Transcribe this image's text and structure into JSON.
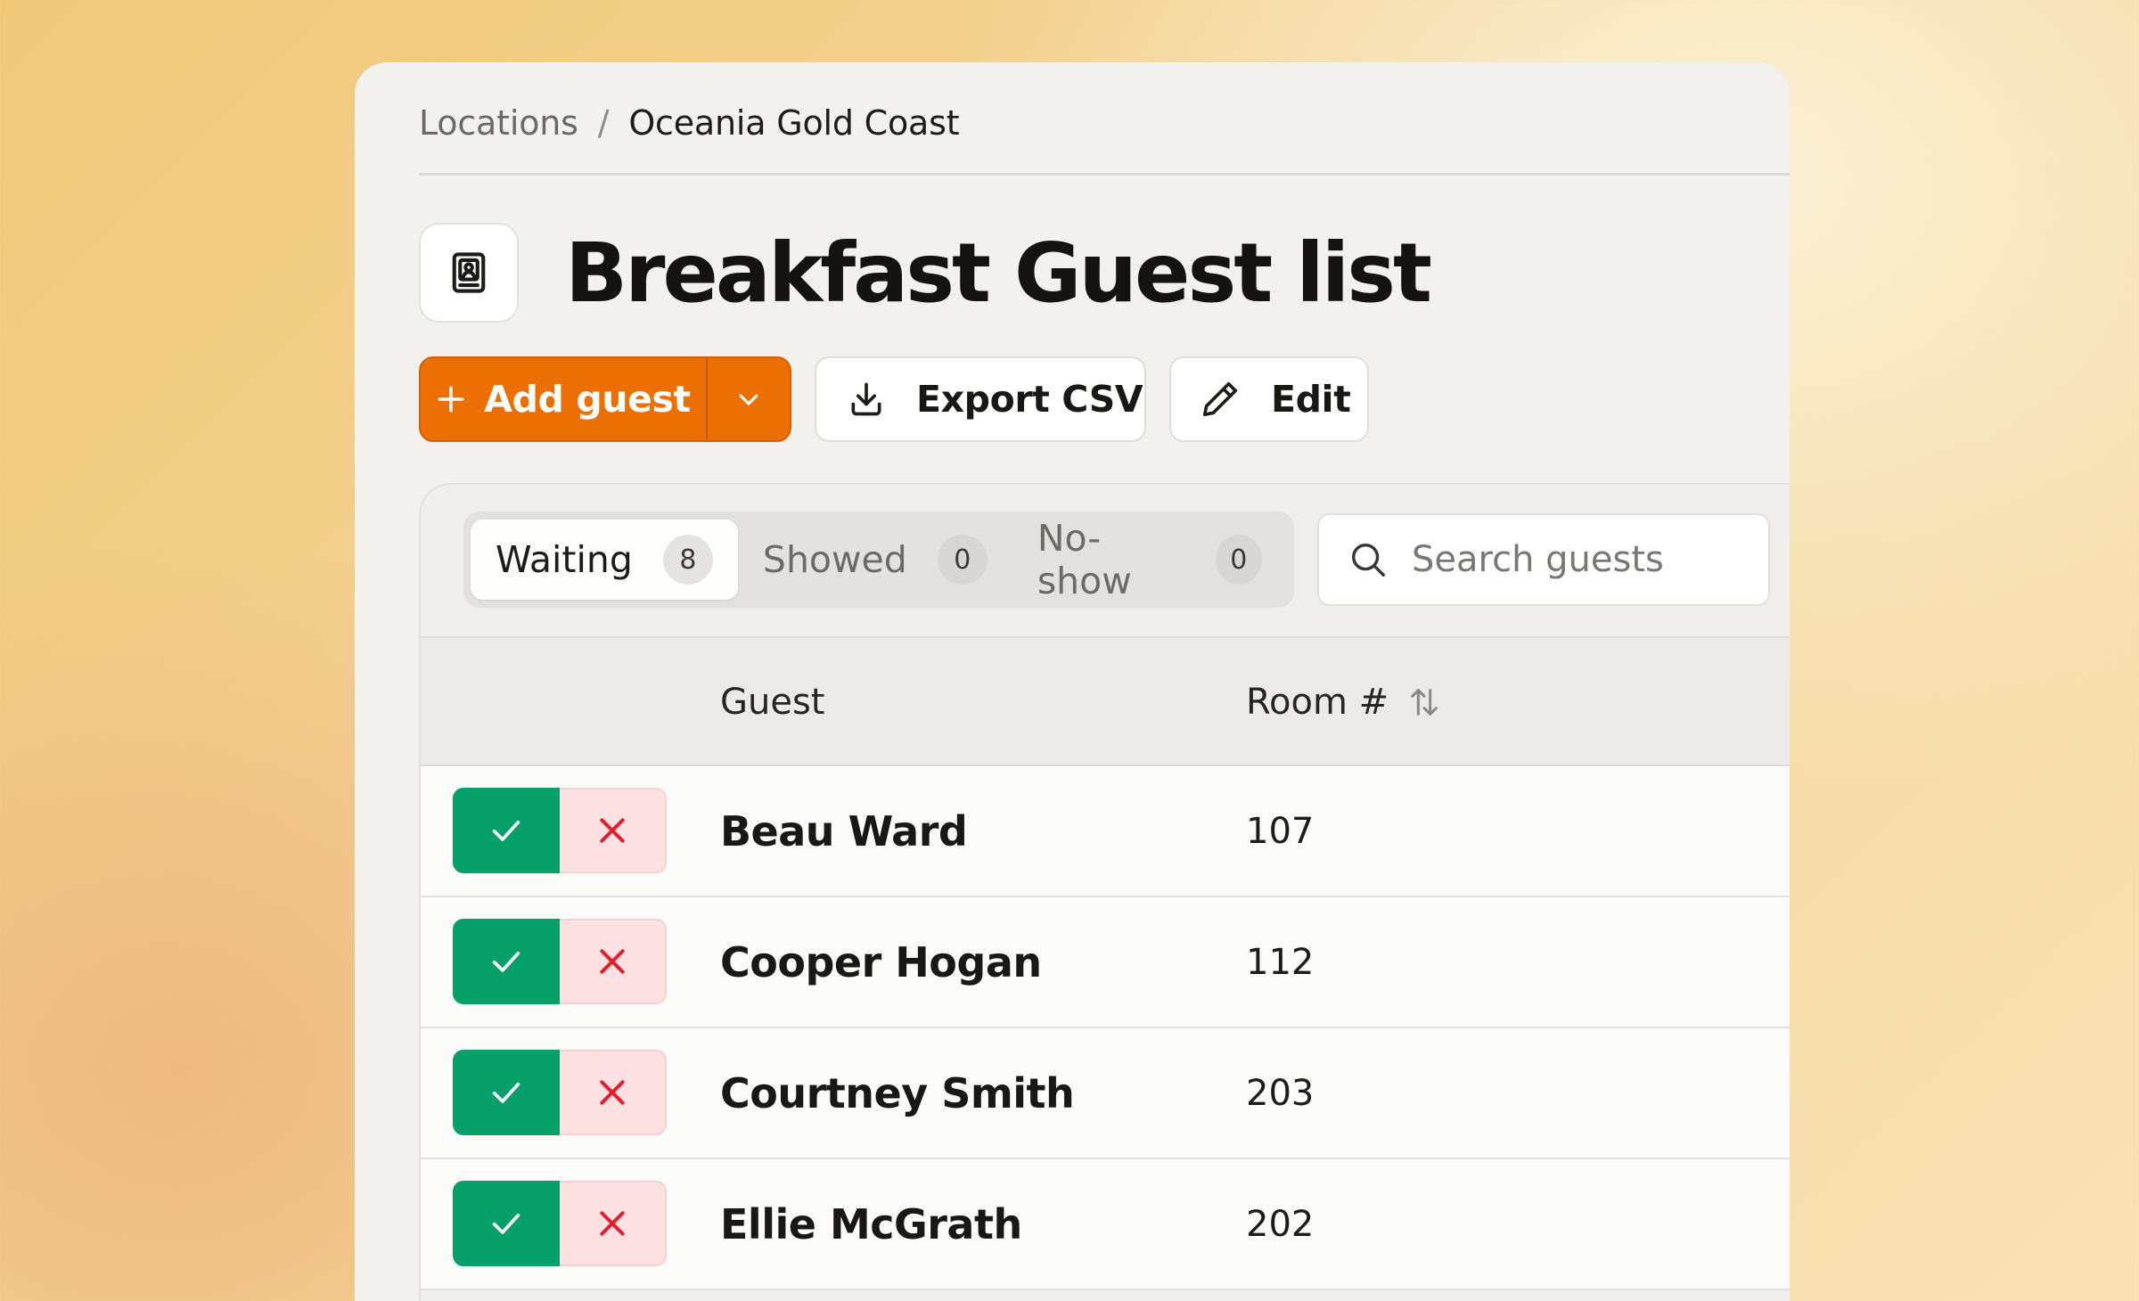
{
  "breadcrumb": {
    "parent": "Locations",
    "separator": "/",
    "current": "Oceania Gold Coast"
  },
  "page": {
    "title": "Breakfast Guest list",
    "icon": "contact-book-icon"
  },
  "actions": {
    "add_guest_label": "Add guest",
    "export_label": "Export CSV",
    "edit_label": "Edit"
  },
  "tabs": [
    {
      "label": "Waiting",
      "count": "8",
      "active": true
    },
    {
      "label": "Showed",
      "count": "0",
      "active": false
    },
    {
      "label": "No-show",
      "count": "0",
      "active": false
    }
  ],
  "search": {
    "placeholder": "Search guests",
    "value": ""
  },
  "table": {
    "columns": [
      "Guest",
      "Room #"
    ],
    "rows": [
      {
        "guest": "Beau Ward",
        "room": "107"
      },
      {
        "guest": "Cooper Hogan",
        "room": "112"
      },
      {
        "guest": "Courtney Smith",
        "room": "203"
      },
      {
        "guest": "Ellie McGrath",
        "room": "202"
      }
    ]
  },
  "colors": {
    "primary": "#ec6f03",
    "confirm": "#07a06a",
    "reject_bg": "#fde1e2",
    "reject_icon": "#e0202a"
  }
}
